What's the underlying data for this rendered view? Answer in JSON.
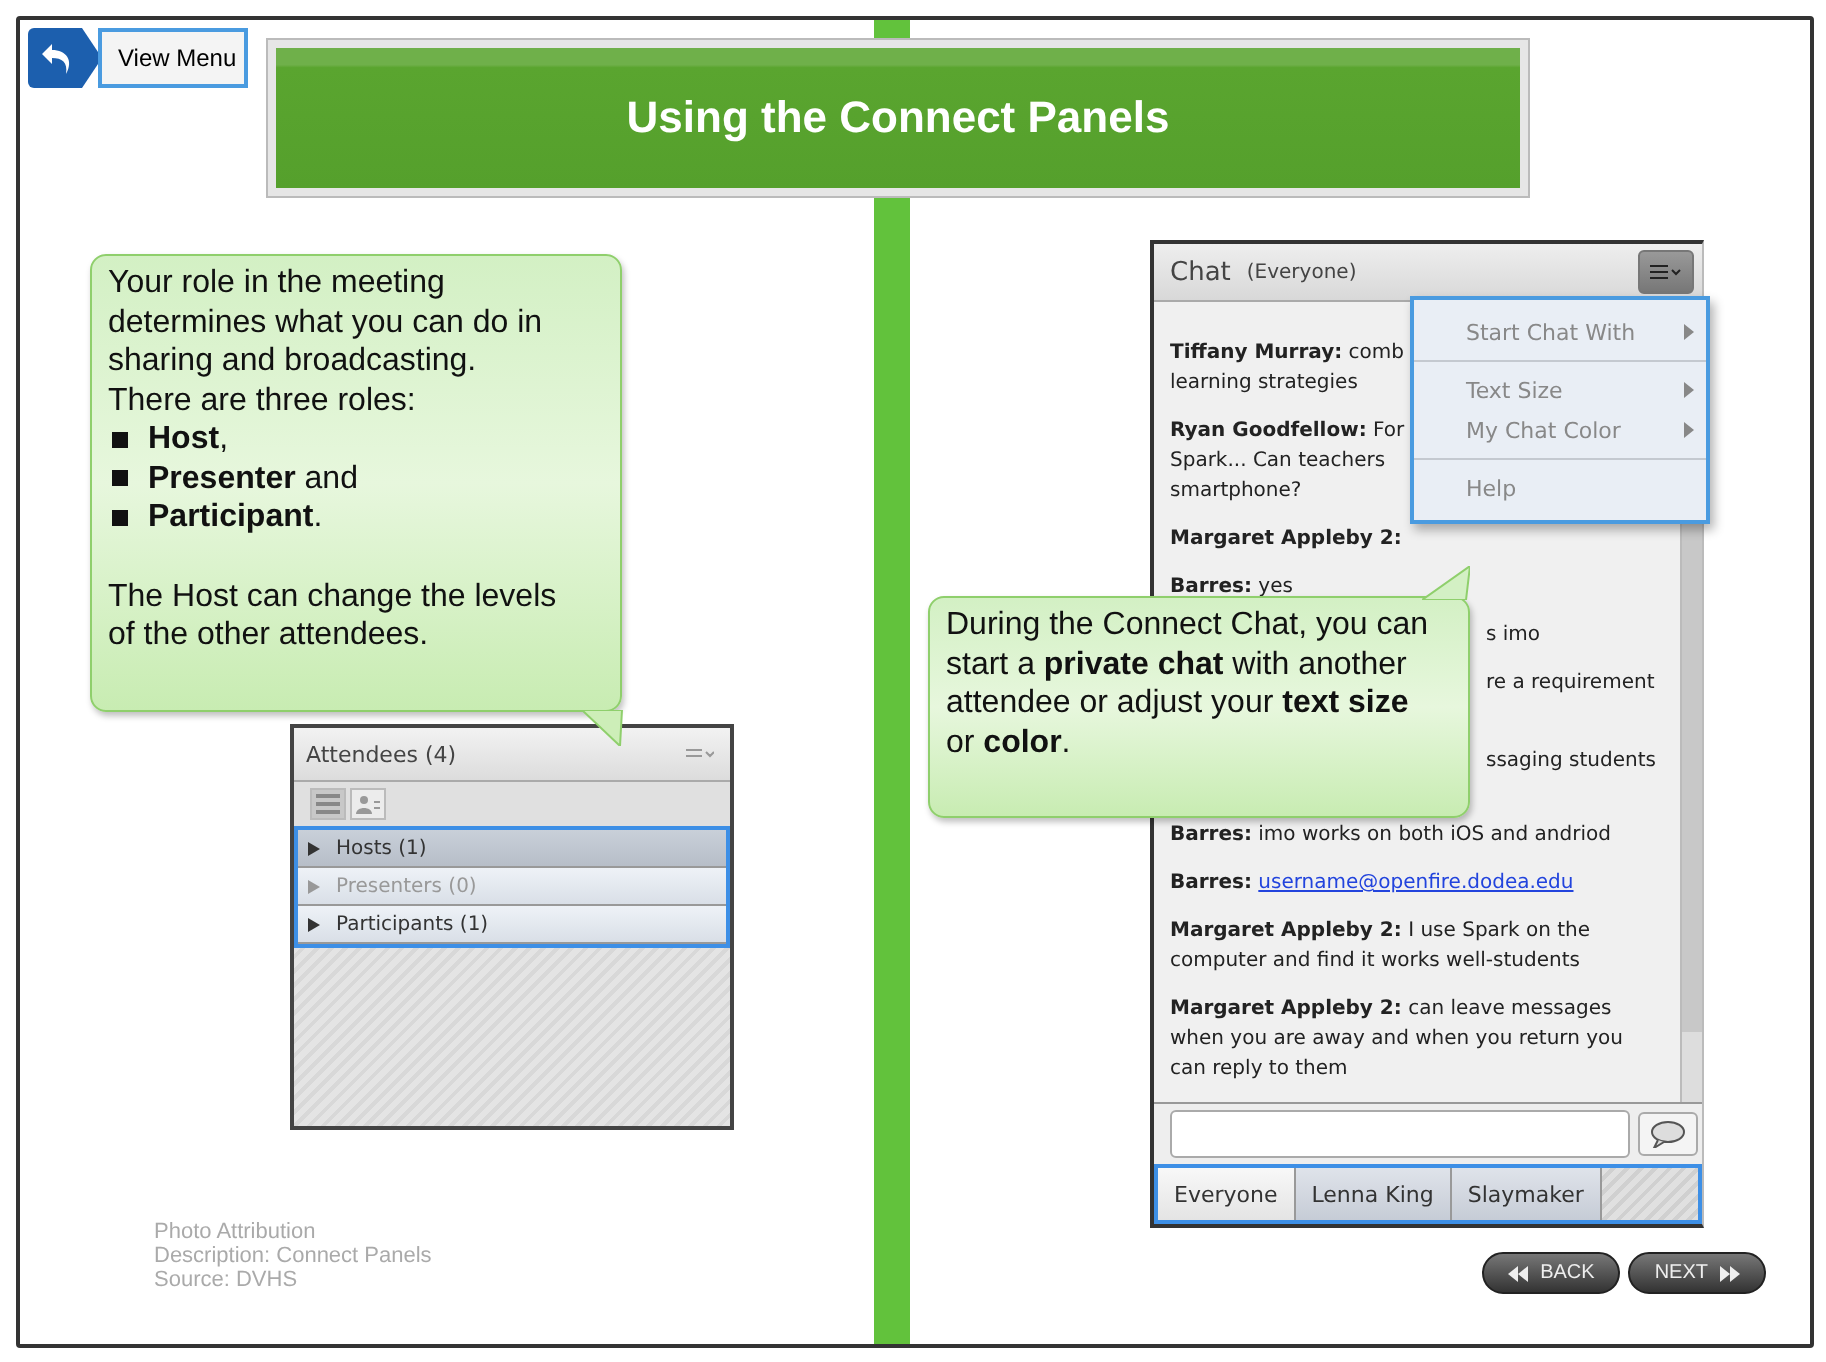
{
  "nav": {
    "view_menu": "View Menu"
  },
  "title": "Using the Connect Panels",
  "left_callout": {
    "intro": [
      "Your role in the meeting determines what you can do in sharing and broadcasting.",
      "There are three roles:"
    ],
    "bullets": [
      "**Host**,",
      "**Presenter** and",
      "**Participant**."
    ],
    "outro": "The Host can change the levels of the other attendees."
  },
  "attendees": {
    "title": "Attendees",
    "count": "(4)",
    "view_toggles": [
      {
        "kind": "list",
        "selected": true
      },
      {
        "kind": "person",
        "selected": false
      }
    ],
    "groups": [
      {
        "label": "Hosts (1)",
        "selected": true,
        "disabled": false
      },
      {
        "label": "Presenters (0)",
        "selected": false,
        "disabled": true
      },
      {
        "label": "Participants (1)",
        "selected": false,
        "disabled": false
      }
    ]
  },
  "attribution": [
    "Photo Attribution",
    "Description: Connect Panels",
    "Source: DVHS"
  ],
  "chat": {
    "title": "Chat",
    "scope": "(Everyone)",
    "messages": [
      {
        "kind": "message",
        "name": "Tiffany Murray:",
        "lines": [
          "comb",
          "learning strategies"
        ]
      },
      {
        "kind": "message",
        "name": "Ryan Goodfellow:",
        "lines": [
          "For",
          "Spark... Can teachers",
          "smartphone?"
        ]
      },
      {
        "kind": "message",
        "name": "Margaret Appleby 2:"
      },
      {
        "kind": "message",
        "name": "Barres:",
        "lines": [
          "yes"
        ]
      },
      {
        "kind": "fragment",
        "lines": [
          "s imo"
        ]
      },
      {
        "kind": "fragment",
        "lines": [
          "re a requirement"
        ]
      },
      {
        "kind": "fragment_wrapped",
        "lines": [
          "ssaging students"
        ]
      },
      {
        "kind": "message",
        "name": "Barres:",
        "lines": [
          "imo works on both iOS and andriod"
        ]
      },
      {
        "kind": "link",
        "name": "Barres:",
        "lines": [
          "username@openfire.dodea.edu"
        ]
      },
      {
        "kind": "message",
        "name": "Margaret Appleby 2:",
        "lines": [
          "I use Spark on the",
          "computer and find it works well-students"
        ]
      },
      {
        "kind": "message",
        "name": "Margaret Appleby 2:",
        "lines": [
          "can leave messages",
          "when you are away and when you return you",
          "can reply to them"
        ]
      }
    ],
    "menu": [
      [
        {
          "label": "Start Chat With",
          "submenu": true
        }
      ],
      [
        {
          "label": "Text Size",
          "submenu": true
        },
        {
          "label": "My Chat Color",
          "submenu": true
        }
      ],
      [
        {
          "label": "Help",
          "submenu": false
        }
      ]
    ],
    "tabs": [
      {
        "label": "Everyone",
        "selected": true
      },
      {
        "label": "Lenna King",
        "selected": false
      },
      {
        "label": "Slaymaker",
        "selected": false
      }
    ]
  },
  "right_callout": "During the Connect Chat, you can start a **private chat** with another attendee or adjust your **text size** or **color**.",
  "buttons": {
    "back": "BACK",
    "next": "NEXT"
  }
}
